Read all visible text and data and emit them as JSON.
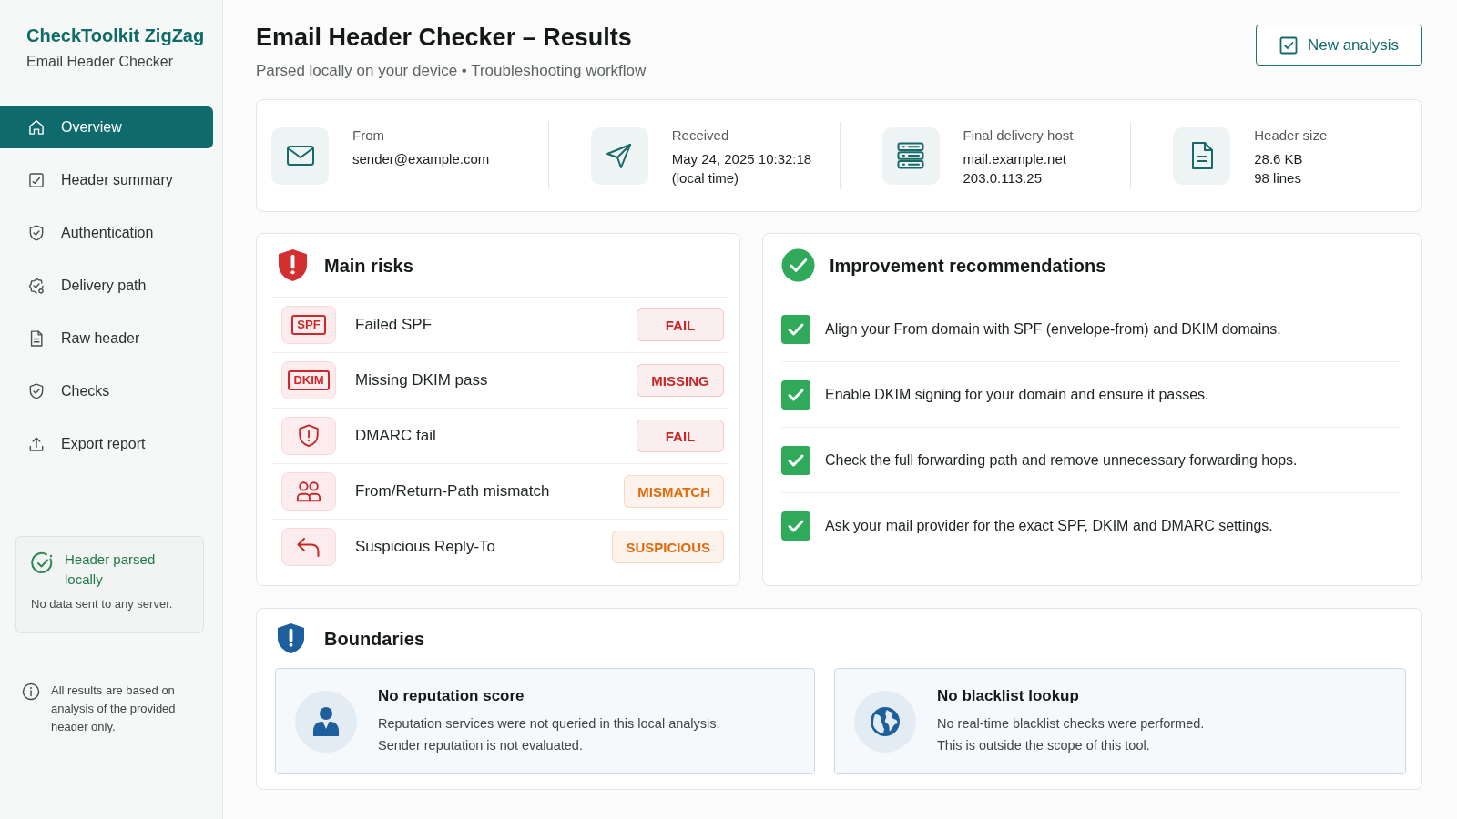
{
  "sidebar": {
    "brand": "CheckToolkit ZigZag",
    "subtitle": "Email Header Checker",
    "nav": [
      {
        "label": "Overview",
        "selected": true
      },
      {
        "label": "Header summary",
        "selected": false
      },
      {
        "label": "Authentication",
        "selected": false
      },
      {
        "label": "Delivery path",
        "selected": false
      },
      {
        "label": "Raw header",
        "selected": false
      },
      {
        "label": "Checks",
        "selected": false
      },
      {
        "label": "Export report",
        "selected": false
      }
    ],
    "status_card": {
      "title": "Header parsed locally",
      "text": "No data sent to any server."
    },
    "note": "All results are based on analysis of the provided header only."
  },
  "header": {
    "title": "Email Header Checker – Results",
    "subtitle": "Parsed locally on your device • Troubleshooting workflow",
    "button": "New analysis"
  },
  "summary": [
    {
      "label": "From",
      "lines": [
        "sender@example.com"
      ]
    },
    {
      "label": "Received",
      "lines": [
        "May 24, 2025 10:32:18",
        "(local time)"
      ]
    },
    {
      "label": "Final delivery host",
      "lines": [
        "mail.example.net",
        "203.0.113.25"
      ]
    },
    {
      "label": "Header size",
      "lines": [
        "28.6 KB",
        "98 lines"
      ]
    }
  ],
  "risks": {
    "title": "Main risks",
    "rows": [
      {
        "kind": "tag",
        "tag": "SPF",
        "label": "Failed SPF",
        "status": "FAIL",
        "color": "#c62828"
      },
      {
        "kind": "tag",
        "tag": "DKIM",
        "label": "Missing DKIM pass",
        "status": "MISSING",
        "color": "#c62828"
      },
      {
        "kind": "icon",
        "label": "DMARC fail",
        "status": "FAIL",
        "color": "#c62828"
      },
      {
        "kind": "icon",
        "label": "From/Return-Path mismatch",
        "status": "MISMATCH",
        "color": "#e06a0c"
      },
      {
        "kind": "icon",
        "label": "Suspicious Reply-To",
        "status": "SUSPICIOUS",
        "color": "#e06a0c"
      }
    ]
  },
  "recommendations": {
    "title": "Improvement recommendations",
    "items": [
      {
        "text": "Align your From domain with SPF (envelope-from) and DKIM domains.",
        "checked": true
      },
      {
        "text": "Enable DKIM signing for your domain and ensure it passes.",
        "checked": true
      },
      {
        "text": "Check the full forwarding path and remove unnecessary forwarding hops.",
        "checked": true
      },
      {
        "text": "Ask your mail provider for the exact SPF, DKIM and DMARC settings.",
        "checked": true
      }
    ]
  },
  "boundaries": {
    "title": "Boundaries",
    "cards": [
      {
        "title": "No reputation score",
        "lines": [
          "Reputation services were not queried in this local analysis.",
          "Sender reputation is not evaluated."
        ]
      },
      {
        "title": "No blacklist lookup",
        "lines": [
          "No real-time blacklist checks were performed.",
          "This is outside the scope of this tool."
        ]
      }
    ]
  }
}
